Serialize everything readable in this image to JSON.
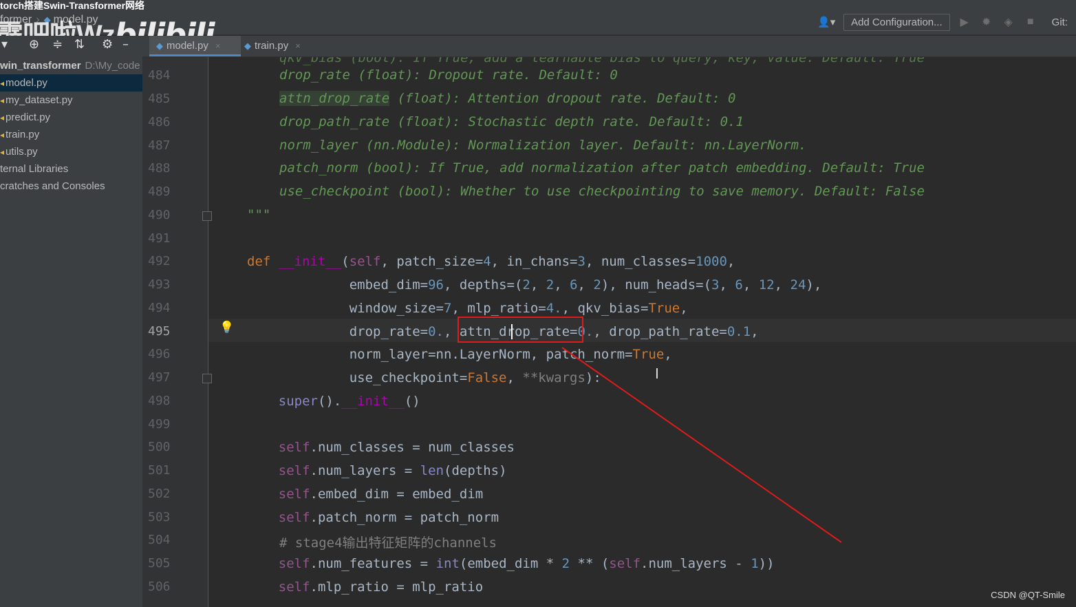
{
  "video_title": "torch搭建Swin-Transformer网络",
  "breadcrumb": {
    "project": "former",
    "file": "model.py"
  },
  "watermark": {
    "text": "霹吧啦Wz",
    "logo": "bilibili"
  },
  "nav_right": {
    "add_config": "Add Configuration...",
    "git": "Git:"
  },
  "sidebar": {
    "root": {
      "name": "win_transformer",
      "path": "D:\\My_code"
    },
    "items": [
      {
        "label": "model.py"
      },
      {
        "label": "my_dataset.py"
      },
      {
        "label": "predict.py"
      },
      {
        "label": "train.py"
      },
      {
        "label": "utils.py"
      },
      {
        "label": "ternal Libraries"
      },
      {
        "label": "cratches and Consoles"
      }
    ]
  },
  "tabs": [
    {
      "label": "model.py",
      "close": "×"
    },
    {
      "label": "train.py",
      "close": "×"
    }
  ],
  "editor": {
    "line_numbers": [
      "484",
      "485",
      "486",
      "487",
      "488",
      "489",
      "490",
      "491",
      "492",
      "493",
      "494",
      "495",
      "496",
      "497",
      "498",
      "499",
      "500",
      "501",
      "502",
      "503",
      "504",
      "505",
      "506"
    ],
    "current_line": "495",
    "doc": {
      "l484": "drop_rate (float): Dropout rate. Default: 0",
      "l485a": "attn_drop_rate",
      "l485b": " (float): Attention dropout rate. Default: 0",
      "l486": "drop_path_rate (float): Stochastic depth rate. Default: 0.1",
      "l487": "norm_layer (nn.Module): Normalization layer. Default: nn.LayerNorm.",
      "l488": "patch_norm (bool): If True, add normalization after patch embedding. Default: True",
      "l489": "use_checkpoint (bool): Whether to use checkpointing to save memory. Default: False",
      "l490": "\"\"\""
    },
    "comment_504": "# stage4输出特征矩阵的channels"
  },
  "csdn": "CSDN @QT-Smile"
}
